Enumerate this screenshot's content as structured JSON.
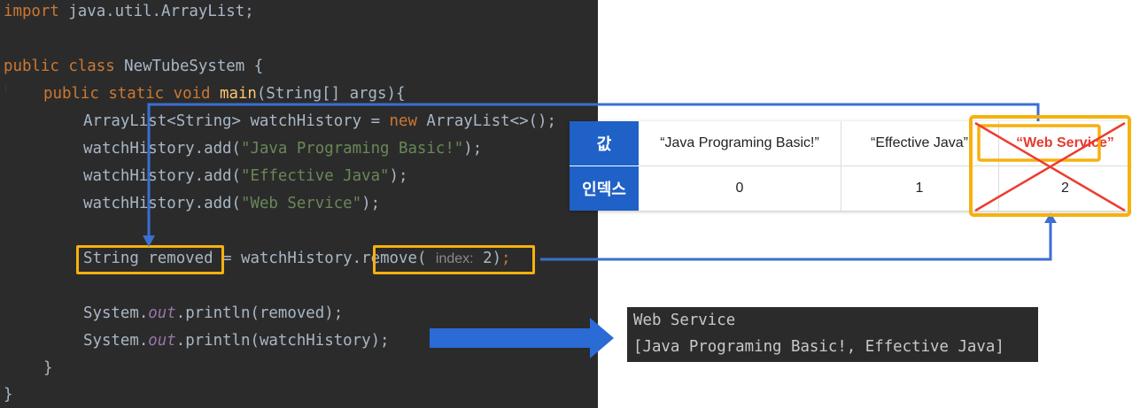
{
  "code": {
    "line1": {
      "kw": "import",
      "rest": " java.util.ArrayList;"
    },
    "line3": {
      "kw1": "public",
      "kw2": "class",
      "rest": " NewTubeSystem {"
    },
    "line4": {
      "kw1": "public",
      "kw2": "static",
      "kw3": "void",
      "fn": "main",
      "rest": "(String[] args){"
    },
    "line5": {
      "a": "ArrayList<String> watchHistory = ",
      "kw": "new",
      "b": " ArrayList<>();"
    },
    "line6": {
      "pre": "watchHistory.add(",
      "str": "\"Java Programing Basic!\"",
      "post": ");"
    },
    "line7": {
      "pre": "watchHistory.add(",
      "str": "\"Effective Java\"",
      "post": ");"
    },
    "line8": {
      "pre": "watchHistory.add(",
      "str": "\"Web Service\"",
      "post": ");"
    },
    "line10": {
      "a": "String removed",
      "b": " = watchHistory",
      "c": ".remove(",
      "hint": "index:",
      "d": "2)",
      "semi": ";"
    },
    "line12": {
      "pre": "System.",
      "fld": "out",
      "post": ".println(removed);"
    },
    "line13": {
      "pre": "System.",
      "fld": "out",
      "post": ".println(watchHistory);"
    },
    "line14": "}",
    "line15": "}"
  },
  "table": {
    "row_value_label": "값",
    "row_index_label": "인덱스",
    "values": [
      "“Java Programing Basic!”",
      "“Effective Java”",
      "“Web Service”"
    ],
    "indices": [
      "0",
      "1",
      "2"
    ]
  },
  "console": {
    "line1": "Web Service",
    "line2": "[Java Programing Basic!, Effective Java]"
  },
  "colors": {
    "highlight": "#f5b10e",
    "arrow": "#3b6fd0",
    "cross": "#ee3b2f",
    "header": "#1f61c7"
  }
}
